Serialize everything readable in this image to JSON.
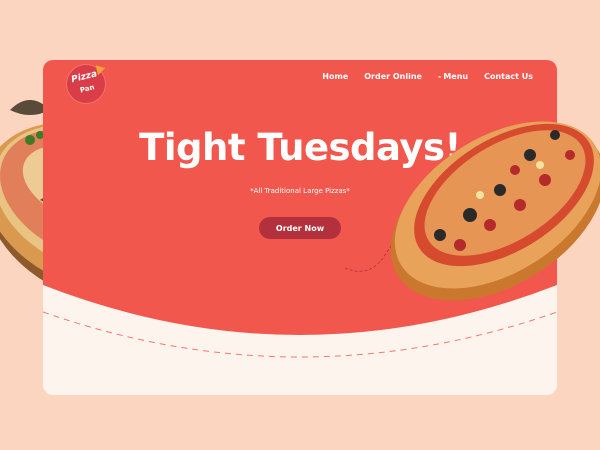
{
  "brand": {
    "logo_line1": "Pizza",
    "logo_line2": "Pan"
  },
  "nav": {
    "items": [
      {
        "label": "Home"
      },
      {
        "label": "Order Online"
      },
      {
        "label": "Menu",
        "prefix": "-"
      },
      {
        "label": "Contact Us"
      }
    ]
  },
  "hero": {
    "headline": "Tight Tuesdays!",
    "subline": "*All Traditional Large Pizzas*",
    "cta_label": "Order Now"
  },
  "colors": {
    "page_bg": "#fcd5c1",
    "hero_bg": "#f2574d",
    "card_bottom": "#fdf4ee",
    "cta_bg": "#b3313c",
    "logo_bg": "#d93d47"
  },
  "images": {
    "left": "pizza-with-basil-and-parsley",
    "right": "pepperoni-and-olive-pizza"
  }
}
